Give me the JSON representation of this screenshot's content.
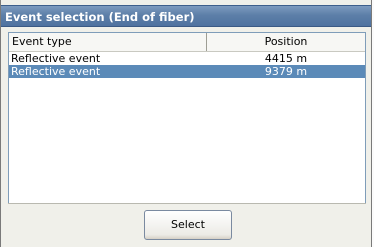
{
  "window": {
    "title": "Event selection (End of fiber)"
  },
  "table": {
    "columns": [
      "Event type",
      "Position"
    ],
    "rows": [
      {
        "event_type": "Reflective event",
        "position": "4415 m",
        "selected": false
      },
      {
        "event_type": "Reflective event",
        "position": "9379 m",
        "selected": true
      }
    ]
  },
  "actions": {
    "select_label": "Select"
  },
  "colors": {
    "title_bar": "#5d7fa8",
    "selection": "#5b8ab8",
    "list_border": "#7f9db9"
  }
}
